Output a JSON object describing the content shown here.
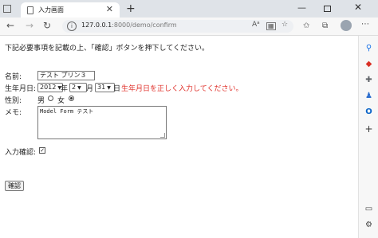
{
  "browser": {
    "tab_title": "入力画面",
    "tab_close": "✕",
    "new_tab": "+",
    "url_host": "127.0.0.1",
    "url_path": ":8000/demo/confirm",
    "back": "←",
    "forward": "→",
    "reload": "↻",
    "home": "⌂",
    "minimize": "—",
    "close": "✕",
    "more": "⋯",
    "read_aloud": "Aᵃ",
    "favorite": "☆",
    "collections": "⧉"
  },
  "page": {
    "instruction": "下記必要事項を記載の上、「確認」ボタンを押下してください。",
    "name_label": "名前:",
    "name_value": "テスト プリン３",
    "birth_label": "生年月日:",
    "year_value": "2012",
    "year_unit": "年",
    "month_value": "2",
    "month_unit": "月",
    "day_value": "31",
    "day_unit": "日",
    "birth_error": "生年月日を正しく入力してください。",
    "gender_label": "性別:",
    "gender_male": "男",
    "gender_female": "女",
    "gender_selected": "female",
    "memo_label": "メモ:",
    "memo_value": "Model Form テスト",
    "confirm_label": "入力確認:",
    "confirm_checked": true,
    "confirm_button": "確認"
  },
  "colors": {
    "error": "#e0312b",
    "sidebar_search": "#1a73e8",
    "sidebar_shop": "#d93025",
    "sidebar_tools": "#5f6368",
    "sidebar_games": "#2f6fce",
    "sidebar_outlook": "#0a64c8"
  }
}
